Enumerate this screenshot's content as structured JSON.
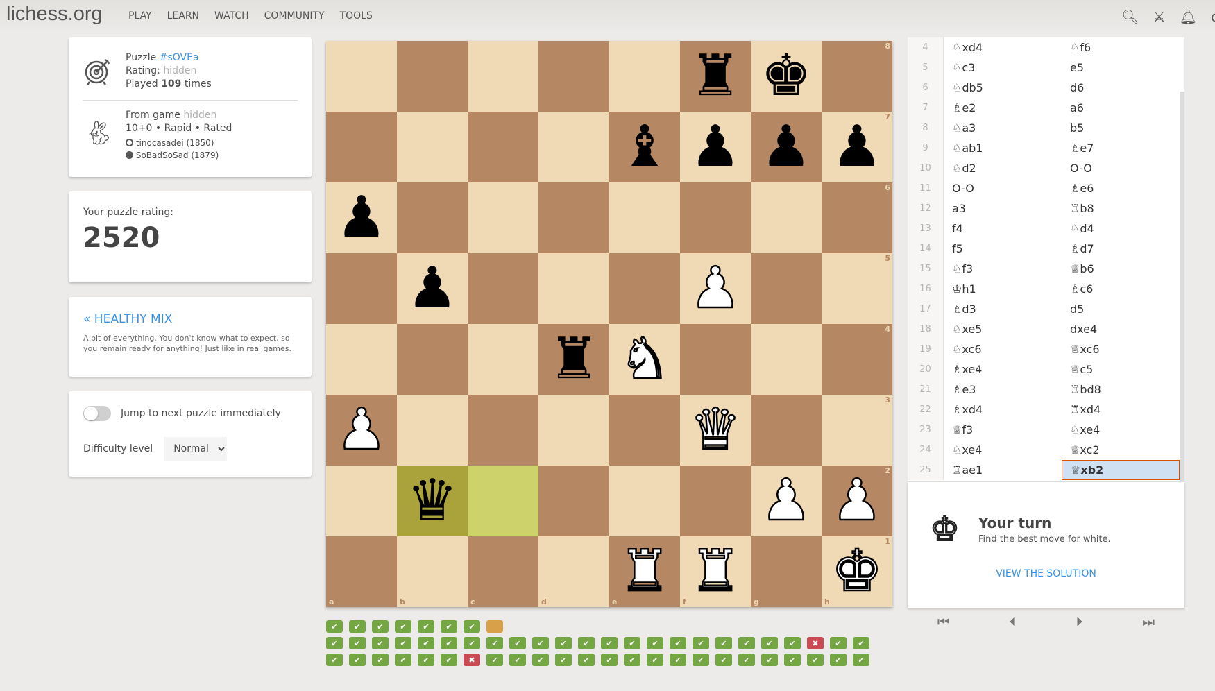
{
  "header": {
    "logo": "lichess.org",
    "nav": [
      "PLAY",
      "LEARN",
      "WATCH",
      "COMMUNITY",
      "TOOLS"
    ],
    "icons": [
      "search-icon",
      "swords-icon",
      "bell-icon"
    ]
  },
  "puzzle": {
    "label": "Puzzle",
    "id": "#sOVEa",
    "rating_label": "Rating:",
    "rating": "hidden",
    "played_pre": "Played",
    "played_count": "109",
    "played_post": "times",
    "game_label": "From game",
    "game": "hidden",
    "game_type": "10+0 • Rapid • Rated",
    "white": "tinocasadei (1850)",
    "black": "SoBadSoSad (1879)"
  },
  "user_rating": {
    "label": "Your puzzle rating:",
    "value": "2520"
  },
  "theme": {
    "title": "« HEALTHY MIX",
    "desc": "A bit of everything. You don't know what to expect, so you remain ready for anything! Just like in real games."
  },
  "settings": {
    "jump_label": "Jump to next puzzle immediately",
    "jump_on": false,
    "difficulty_label": "Difficulty level",
    "difficulty": "Normal"
  },
  "board": {
    "colors": {
      "light": "#f0d9b5",
      "dark": "#b58863",
      "last_light": "#cdd26a",
      "last_dark": "#aaa23a"
    },
    "ranks": [
      "8",
      "7",
      "6",
      "5",
      "4",
      "3",
      "2",
      "1"
    ],
    "files": [
      "a",
      "b",
      "c",
      "d",
      "e",
      "f",
      "g",
      "h"
    ],
    "last_move": [
      "c2",
      "b2"
    ],
    "pieces": {
      "f8": "bR",
      "g8": "bK",
      "e7": "bB",
      "f7": "bP",
      "g7": "bP",
      "h7": "bP",
      "a6": "bP",
      "b5": "bP",
      "f5": "wP",
      "d4": "bR",
      "e4": "wN",
      "a3": "wP",
      "f3": "wQ",
      "b2": "bQ",
      "g2": "wP",
      "h2": "wP",
      "e1": "wR",
      "f1": "wR",
      "h1": "wK"
    }
  },
  "moves": [
    [
      "4",
      "♘xd4",
      "♘f6"
    ],
    [
      "5",
      "♘c3",
      "e5"
    ],
    [
      "6",
      "♘db5",
      "d6"
    ],
    [
      "7",
      "♗e2",
      "a6"
    ],
    [
      "8",
      "♘a3",
      "b5"
    ],
    [
      "9",
      "♘ab1",
      "♗e7"
    ],
    [
      "10",
      "♘d2",
      "O-O"
    ],
    [
      "11",
      "O-O",
      "♗e6"
    ],
    [
      "12",
      "a3",
      "♖b8"
    ],
    [
      "13",
      "f4",
      "♘d4"
    ],
    [
      "14",
      "f5",
      "♗d7"
    ],
    [
      "15",
      "♘f3",
      "♕b6"
    ],
    [
      "16",
      "♔h1",
      "♗c6"
    ],
    [
      "17",
      "♗d3",
      "d5"
    ],
    [
      "18",
      "♘xe5",
      "dxe4"
    ],
    [
      "19",
      "♘xc6",
      "♕xc6"
    ],
    [
      "20",
      "♗xe4",
      "♕c5"
    ],
    [
      "21",
      "♗e3",
      "♖bd8"
    ],
    [
      "22",
      "♗xd4",
      "♖xd4"
    ],
    [
      "23",
      "♕f3",
      "♘xe4"
    ],
    [
      "24",
      "♘xe4",
      "♕xc2"
    ],
    [
      "25",
      "♖ae1",
      "♕xb2"
    ]
  ],
  "turn": {
    "title": "Your turn",
    "desc": "Find the best move for white.",
    "solution": "VIEW THE SOLUTION"
  },
  "controls": [
    "first-icon",
    "prev-icon",
    "next-icon",
    "last-icon"
  ],
  "progress": [
    [
      "good",
      "good",
      "good",
      "good",
      "good",
      "good",
      "good",
      "current"
    ],
    [
      "good",
      "good",
      "good",
      "good",
      "good",
      "good",
      "good",
      "good",
      "good",
      "good",
      "good",
      "good",
      "good",
      "good",
      "good",
      "good",
      "good",
      "good",
      "good",
      "good",
      "good",
      "bad",
      "good",
      "good"
    ],
    [
      "good",
      "good",
      "good",
      "good",
      "good",
      "good",
      "bad",
      "good",
      "good",
      "good",
      "good",
      "good",
      "good",
      "good",
      "good",
      "good",
      "good",
      "good",
      "good",
      "good",
      "good",
      "good",
      "good",
      "good"
    ]
  ]
}
